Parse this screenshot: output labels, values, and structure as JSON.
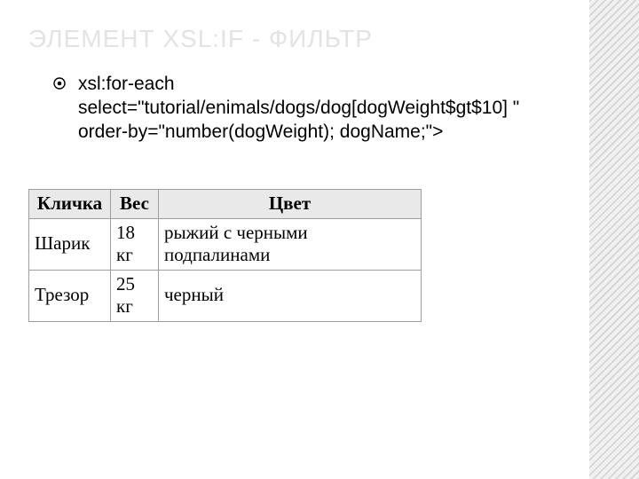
{
  "title": "ЭЛЕМЕНТ XSL:IF - ФИЛЬТР",
  "bullet": {
    "text": "xsl:for-each select=\"tutorial/enimals/dogs/dog[dogWeight$gt$10] \" order-by=\"number(dogWeight); dogName;\">"
  },
  "table": {
    "headers": {
      "name": "Кличка",
      "weight": "Вес",
      "color": "Цвет"
    },
    "rows": [
      {
        "name": "Шарик",
        "weight": "18 кг",
        "color": "рыжий с черными подпалинами"
      },
      {
        "name": "Трезор",
        "weight": "25 кг",
        "color": "черный"
      }
    ]
  }
}
